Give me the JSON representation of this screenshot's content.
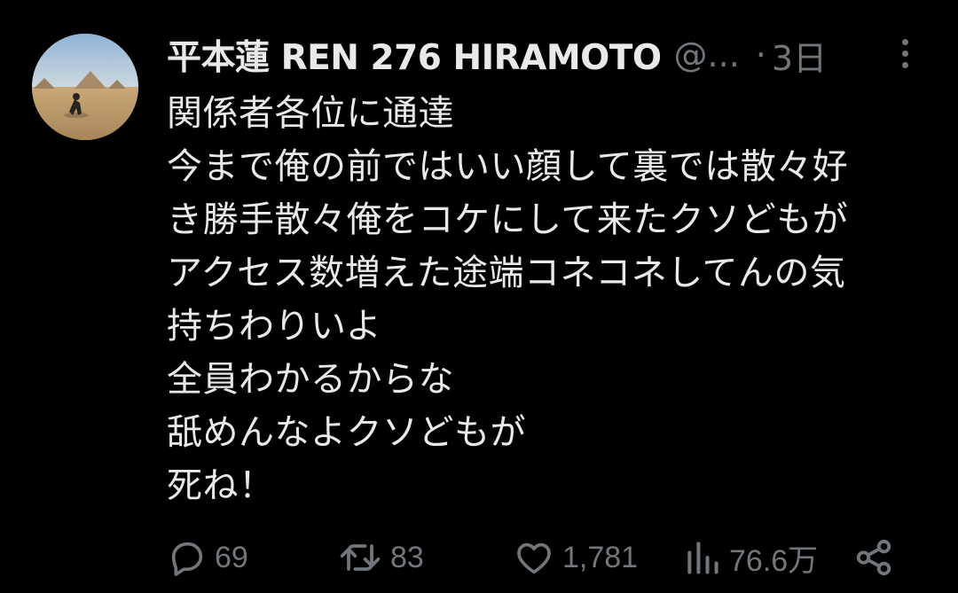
{
  "tweet": {
    "display_name": "平本蓮 REN 276 HIRAMOTO",
    "handle": "@...",
    "separator": "·",
    "time": "3日",
    "lines": [
      "関係者各位に通達",
      "今まで俺の前ではいい顔して裏では散々好",
      "き勝手散々俺をコケにして来たクソどもが",
      "アクセス数増えた途端コネコネしてんの気",
      "持ちわりいよ",
      "全員わかるからな",
      "舐めんなよクソどもが",
      "死ね！"
    ]
  },
  "actions": {
    "reply_count": "69",
    "retweet_count": "83",
    "like_count": "1,781",
    "views_count": "76.6万"
  },
  "icons": {
    "more": "more-dots-icon",
    "reply": "reply-bubble-icon",
    "retweet": "retweet-icon",
    "like": "heart-icon",
    "views": "views-bars-icon",
    "share": "share-icon"
  },
  "colors": {
    "background": "#000000",
    "text": "#e7e9ea",
    "secondary": "#71767b"
  }
}
